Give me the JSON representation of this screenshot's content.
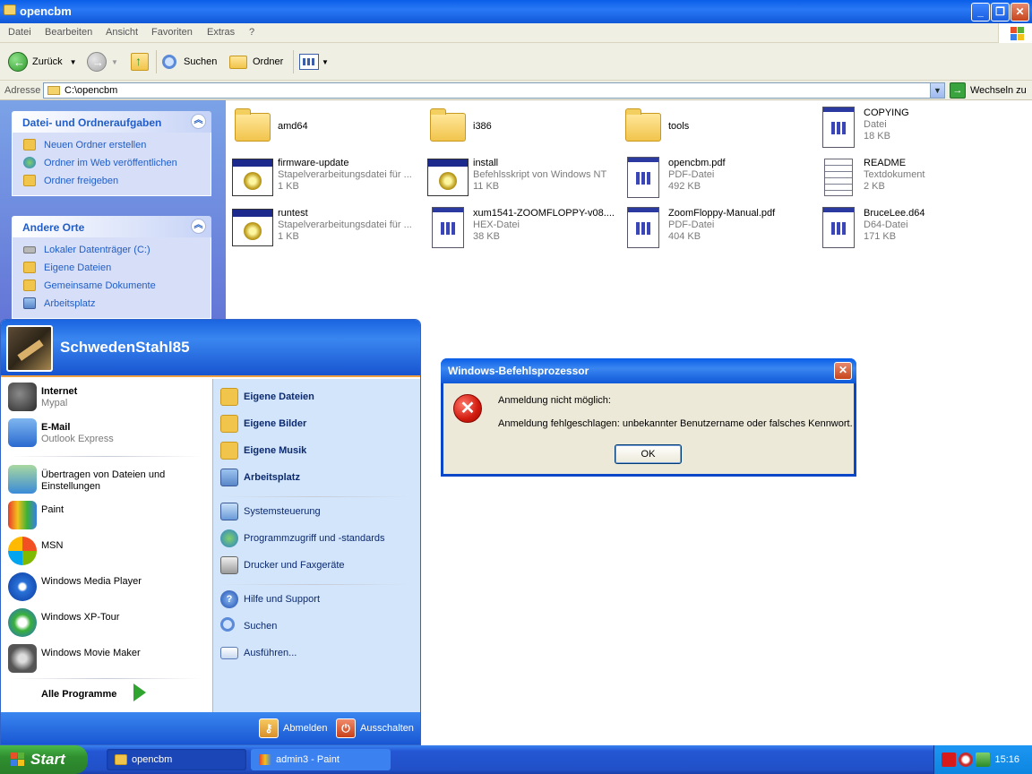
{
  "window": {
    "title": "opencbm"
  },
  "menubar": {
    "items": [
      "Datei",
      "Bearbeiten",
      "Ansicht",
      "Favoriten",
      "Extras",
      "?"
    ]
  },
  "toolbar": {
    "back": "Zurück",
    "search": "Suchen",
    "folders": "Ordner"
  },
  "addressbar": {
    "label": "Adresse",
    "path": "C:\\opencbm",
    "go": "Wechseln zu"
  },
  "taskpane": {
    "panel1": {
      "title": "Datei- und Ordneraufgaben",
      "items": [
        "Neuen Ordner erstellen",
        "Ordner im Web veröffentlichen",
        "Ordner freigeben"
      ]
    },
    "panel2": {
      "title": "Andere Orte",
      "items": [
        "Lokaler Datenträger (C:)",
        "Eigene Dateien",
        "Gemeinsame Dokumente",
        "Arbeitsplatz"
      ]
    }
  },
  "files": [
    {
      "name": "amd64",
      "type": "",
      "size": "",
      "icon": "folder-icon"
    },
    {
      "name": "i386",
      "type": "",
      "size": "",
      "icon": "folder-icon"
    },
    {
      "name": "tools",
      "type": "",
      "size": "",
      "icon": "folder-icon"
    },
    {
      "name": "COPYING",
      "type": "Datei",
      "size": "18 KB",
      "icon": "file-icon"
    },
    {
      "name": "firmware-update",
      "type": "Stapelverarbeitungsdatei für ...",
      "size": "1 KB",
      "icon": "batch-file-icon"
    },
    {
      "name": "install",
      "type": "Befehlsskript von Windows NT",
      "size": "11 KB",
      "icon": "batch-file-icon"
    },
    {
      "name": "opencbm.pdf",
      "type": "PDF-Datei",
      "size": "492 KB",
      "icon": "file-icon"
    },
    {
      "name": "README",
      "type": "Textdokument",
      "size": "2 KB",
      "icon": "text-file-icon"
    },
    {
      "name": "runtest",
      "type": "Stapelverarbeitungsdatei für ...",
      "size": "1 KB",
      "icon": "batch-file-icon"
    },
    {
      "name": "xum1541-ZOOMFLOPPY-v08....",
      "type": "HEX-Datei",
      "size": "38 KB",
      "icon": "file-icon"
    },
    {
      "name": "ZoomFloppy-Manual.pdf",
      "type": "PDF-Datei",
      "size": "404 KB",
      "icon": "file-icon"
    },
    {
      "name": "BruceLee.d64",
      "type": "D64-Datei",
      "size": "171 KB",
      "icon": "file-icon"
    }
  ],
  "startmenu": {
    "username": "SchwedenStahl85",
    "pinned": [
      {
        "name": "Internet",
        "sub": "Mypal"
      },
      {
        "name": "E-Mail",
        "sub": "Outlook Express"
      }
    ],
    "recent": [
      {
        "name": "Übertragen von Dateien und Einstellungen"
      },
      {
        "name": "Paint"
      },
      {
        "name": "MSN"
      },
      {
        "name": "Windows Media Player"
      },
      {
        "name": "Windows XP-Tour"
      },
      {
        "name": "Windows Movie Maker"
      }
    ],
    "all_programs": "Alle Programme",
    "places": [
      "Eigene Dateien",
      "Eigene Bilder",
      "Eigene Musik",
      "Arbeitsplatz"
    ],
    "system": [
      "Systemsteuerung",
      "Programmzugriff und -standards",
      "Drucker und Faxgeräte"
    ],
    "help": [
      "Hilfe und Support",
      "Suchen",
      "Ausführen..."
    ],
    "logoff": "Abmelden",
    "shutdown": "Ausschalten"
  },
  "dialog": {
    "title": "Windows-Befehlsprozessor",
    "line1": "Anmeldung nicht möglich:",
    "line2": "Anmeldung fehlgeschlagen: unbekannter Benutzername oder falsches Kennwort.",
    "ok": "OK"
  },
  "taskbar": {
    "start": "Start",
    "tasks": [
      {
        "label": "opencbm",
        "active": true
      },
      {
        "label": "admin3 - Paint",
        "active": false
      }
    ],
    "clock": "15:16"
  }
}
